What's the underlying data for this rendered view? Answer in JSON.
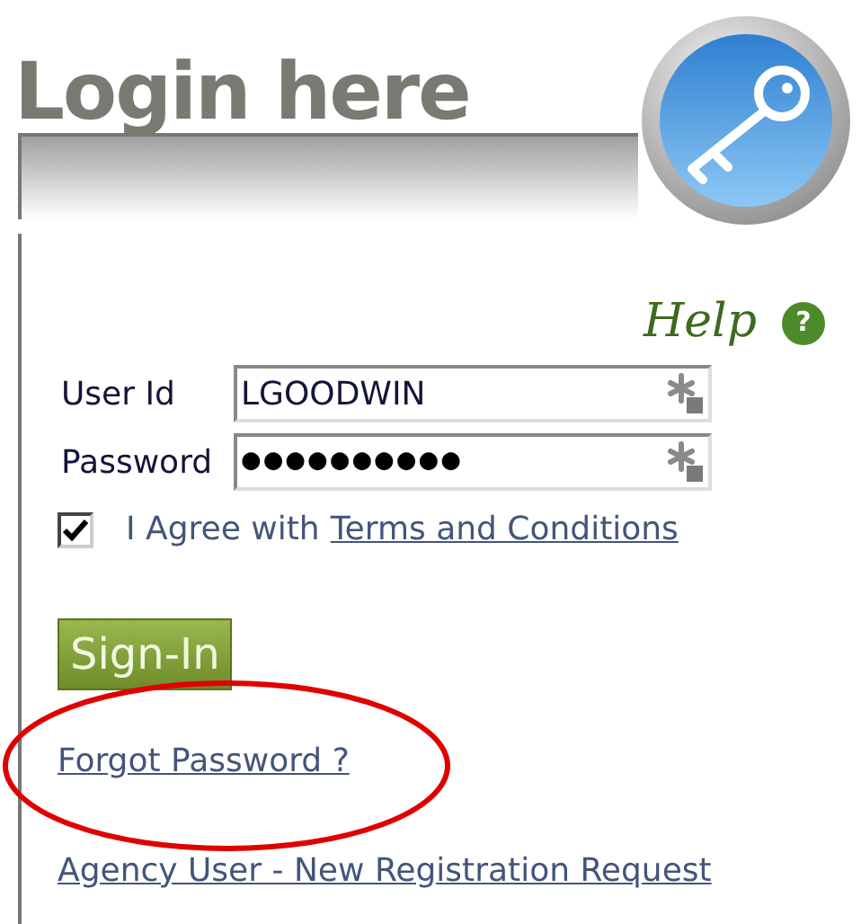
{
  "title": "Login here",
  "help": {
    "label": "Help",
    "icon": "?"
  },
  "fields": [
    {
      "label": "User Id",
      "value": "LGOODWIN"
    },
    {
      "label": "Password",
      "value": "●●●●●●●●●●"
    }
  ],
  "agree": {
    "checked": true,
    "text": "I Agree with",
    "link": "Terms and Conditions"
  },
  "sign_in": "Sign-In",
  "links": [
    {
      "label": "Forgot Password ?",
      "circled": true
    },
    {
      "label": "Agency User - New Registration Request",
      "circled": false
    }
  ]
}
